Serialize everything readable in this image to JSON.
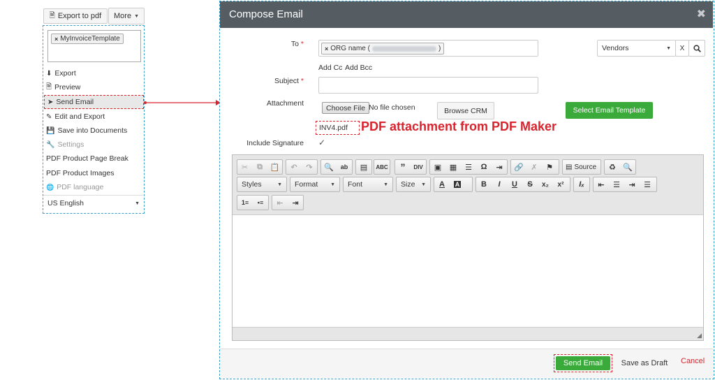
{
  "left_panel": {
    "export_pdf_label": "Export to pdf",
    "more_label": "More",
    "template_tag": "MyInvoiceTemplate",
    "menu": [
      {
        "label": "Export",
        "icon": "download-icon",
        "disabled": false
      },
      {
        "label": "Preview",
        "icon": "file-icon",
        "disabled": false
      },
      {
        "label": "Send Email",
        "icon": "paper-plane-icon",
        "disabled": false
      },
      {
        "label": "Edit and Export",
        "icon": "edit-icon",
        "disabled": false
      },
      {
        "label": "Save into Documents",
        "icon": "save-icon",
        "disabled": false
      },
      {
        "label": "Settings",
        "icon": "wrench-icon",
        "disabled": true
      },
      {
        "label": "PDF Product Page Break",
        "icon": "",
        "disabled": false
      },
      {
        "label": "PDF Product Images",
        "icon": "",
        "disabled": false
      },
      {
        "label": "PDF language",
        "icon": "language-icon",
        "disabled": true
      }
    ],
    "language_value": "US English"
  },
  "modal": {
    "title": "Compose Email",
    "to_label": "To",
    "to_chip": "ORG name (",
    "to_chip_end": ")",
    "add_cc": "Add Cc",
    "add_bcc": "Add Bcc",
    "vendor_select": "Vendors",
    "clear_x": "X",
    "subject_label": "Subject",
    "subject_value": "",
    "attachment_label": "Attachment",
    "choose_file": "Choose File",
    "no_file": "No file chosen",
    "browse_crm": "Browse CRM",
    "select_template": "Select Email Template",
    "attached_file": "INV4.pdf",
    "annotation": "PDF attachment from PDF Maker",
    "include_signature_label": "Include Signature",
    "include_signature_checked": true,
    "toolbar": {
      "source": "Source",
      "styles": "Styles",
      "format": "Format",
      "font": "Font",
      "size": "Size"
    },
    "send_email": "Send Email",
    "save_draft": "Save as Draft",
    "cancel": "Cancel"
  },
  "colors": {
    "accent_blue": "#3aa0c8",
    "highlight_red": "#d9232d",
    "header_bg": "#555d63",
    "success_green": "#3aaa3a"
  }
}
